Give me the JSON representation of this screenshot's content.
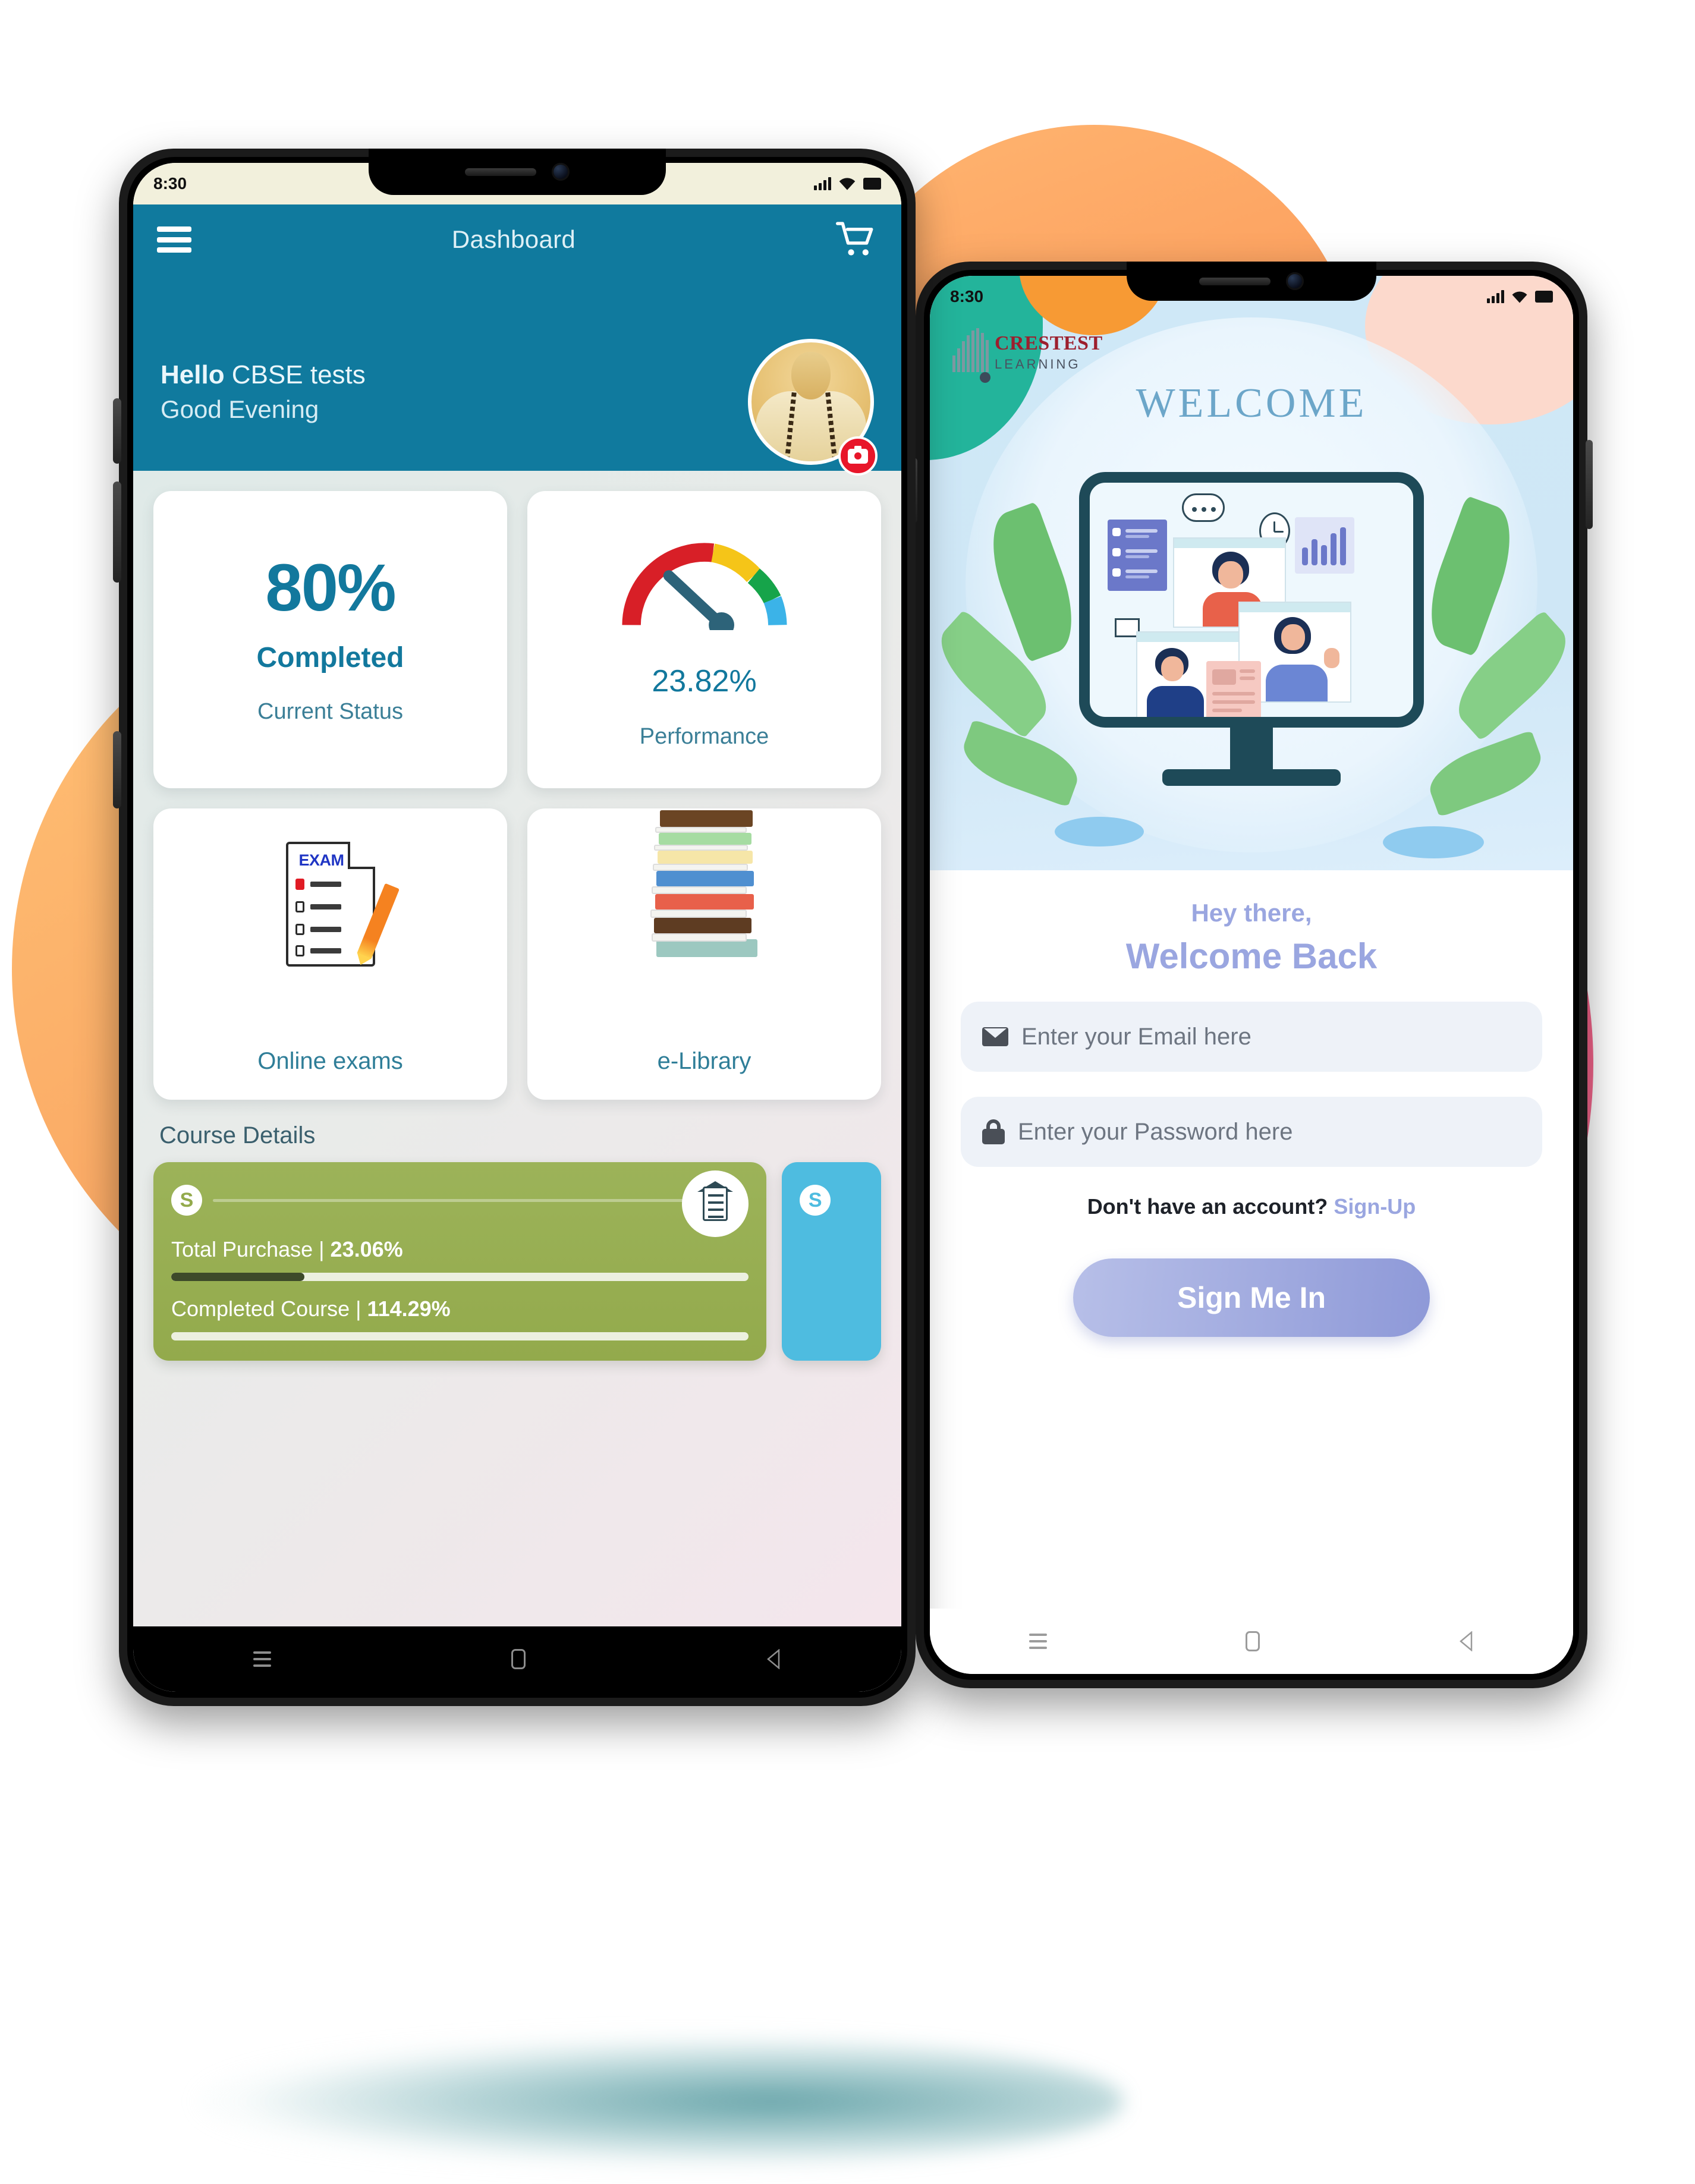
{
  "phone1": {
    "status_bar": {
      "time": "8:30",
      "signal_icon": "signal-bars-icon",
      "wifi_icon": "wifi-icon",
      "battery_icon": "battery-icon"
    },
    "appbar": {
      "menu_icon": "hamburger-menu-icon",
      "title": "Dashboard",
      "cart_icon": "shopping-cart-icon"
    },
    "hero": {
      "greeting_strong": "Hello",
      "greeting_name": " CBSE tests",
      "greeting_time": "Good Evening",
      "avatar_name": "user-avatar",
      "camera_badge": "camera-badge-icon"
    },
    "metrics": [
      {
        "value": "80%",
        "middle": "Completed",
        "caption": "Current Status",
        "kind": "percent"
      },
      {
        "value": "23.82%",
        "middle": "",
        "caption": "Performance",
        "kind": "gauge"
      }
    ],
    "tiles": [
      {
        "label": "Online exams",
        "icon": "exam-paper-icon",
        "exam_word": "EXAM"
      },
      {
        "label": "e-Library",
        "icon": "book-stack-icon"
      }
    ],
    "course_section": {
      "title": "Course Details",
      "cards": [
        {
          "color": "#93aa4c",
          "badge": "S",
          "medal_icon": "graduation-certificate-icon",
          "rows": [
            {
              "label": "Total Purchase",
              "separator": "|",
              "value": "23.06%",
              "fill_percent": 23.06
            },
            {
              "label": "Completed Course",
              "separator": "|",
              "value": "114.29%",
              "fill_percent": 100
            }
          ]
        },
        {
          "color": "#4ebce0",
          "badge": "S",
          "rows": []
        }
      ]
    },
    "navbar": {
      "recents": "recents-icon",
      "home": "home-icon",
      "back": "back-icon"
    }
  },
  "phone2": {
    "status_bar": {
      "time": "8:30",
      "signal_icon": "signal-bars-icon",
      "wifi_icon": "wifi-icon",
      "battery_icon": "battery-icon"
    },
    "brand": {
      "line1": "CRESTEST",
      "line2": "LEARNING",
      "mark": "brand-bars-logo"
    },
    "hero": {
      "welcome_word": "WELCOME",
      "illustration": "video-conference-illustration"
    },
    "form": {
      "hey_text": "Hey there,",
      "welcome_back": "Welcome Back",
      "email_placeholder": "Enter your Email here",
      "email_value": "",
      "email_icon": "mail-icon",
      "password_placeholder": "Enter your Password here",
      "password_value": "",
      "password_icon": "lock-icon",
      "signup_prompt": "Don't have an account?",
      "signup_link": "Sign-Up",
      "signin_button": "Sign Me In"
    },
    "navbar": {
      "recents": "recents-icon",
      "home": "home-icon",
      "back": "back-icon"
    }
  },
  "theme": {
    "teal": "#107a9e",
    "green": "#93aa4c",
    "blue_card": "#4ebce0",
    "periwinkle": "#9aa6e0",
    "orange_blob": "#f79a5b",
    "pink_blob": "#f0486f"
  }
}
